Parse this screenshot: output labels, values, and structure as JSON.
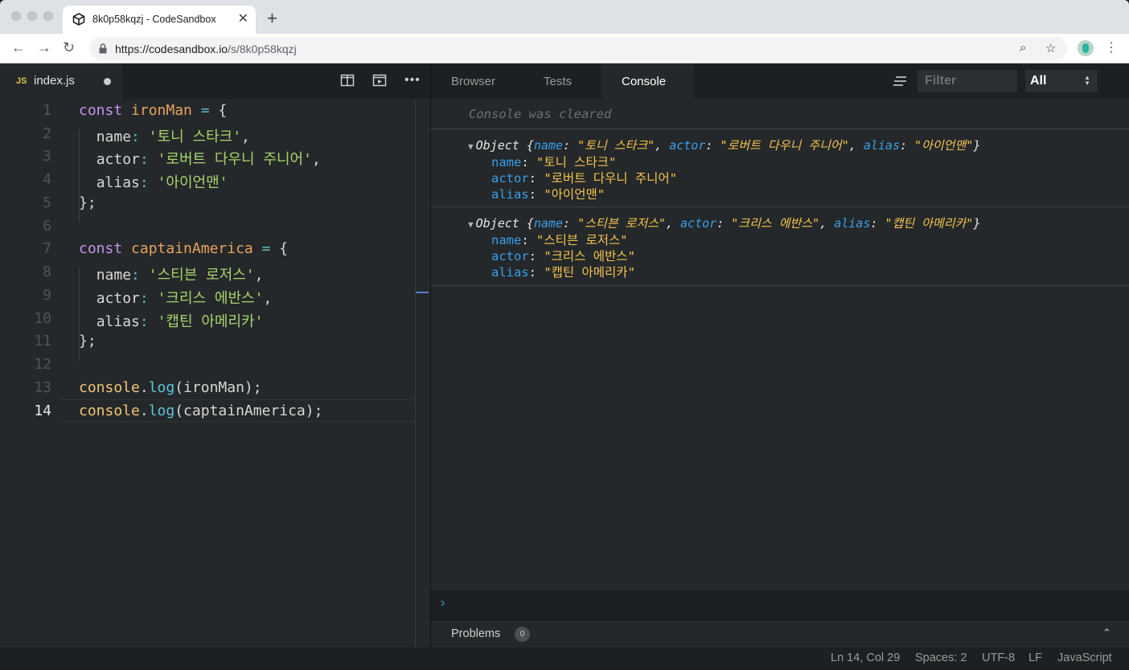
{
  "browser": {
    "tab_title": "8k0p58kqzj - CodeSandbox",
    "tab_close": "✕",
    "new_tab": "+",
    "url_host": "https://codesandbox.io",
    "url_path": "/s/8k0p58kqzj",
    "icons": [
      "back-arrow-icon",
      "forward-arrow-icon",
      "reload-icon",
      "lock-icon",
      "zoom-icon",
      "star-icon",
      "avatar",
      "kebab-menu-icon"
    ]
  },
  "editor": {
    "file_badge": "JS",
    "file_name": "index.js",
    "line_numbers": [
      "1",
      "2",
      "3",
      "4",
      "5",
      "6",
      "7",
      "8",
      "9",
      "10",
      "11",
      "12",
      "13",
      "14"
    ],
    "active_line": "14",
    "code": {
      "l1": {
        "kw": "const",
        "var": "ironMan",
        "op": "=",
        "punc": "{"
      },
      "l2": {
        "key": "name",
        "colon": ":",
        "str": "'토니 스타크'",
        "comma": ","
      },
      "l3": {
        "key": "actor",
        "colon": ":",
        "str": "'로버트 다우니 주니어'",
        "comma": ","
      },
      "l4": {
        "key": "alias",
        "colon": ":",
        "str": "'아이언맨'"
      },
      "l5": "};",
      "l7": {
        "kw": "const",
        "var": "captainAmerica",
        "op": "=",
        "punc": "{"
      },
      "l8": {
        "key": "name",
        "colon": ":",
        "str": "'스티븐 로저스'",
        "comma": ","
      },
      "l9": {
        "key": "actor",
        "colon": ":",
        "str": "'크리스 에반스'",
        "comma": ","
      },
      "l10": {
        "key": "alias",
        "colon": ":",
        "str": "'캡틴 아메리카'"
      },
      "l11": "};",
      "l13": {
        "obj": "console",
        "dot": ".",
        "fn": "log",
        "args": "(ironMan);"
      },
      "l14": {
        "obj": "console",
        "dot": ".",
        "fn": "log",
        "args": "(captainAmerica);"
      }
    }
  },
  "panel": {
    "tabs": [
      "Browser",
      "Tests",
      "Console"
    ],
    "active_tab": "Console",
    "filter_placeholder": "Filter",
    "level_selected": "All",
    "cleared_message": "Console was cleared",
    "entries": [
      {
        "type_label": "Object",
        "open_brace": "{",
        "close_brace": "}",
        "props": [
          {
            "key": "name",
            "value": "\"토니 스타크\""
          },
          {
            "key": "actor",
            "value": "\"로버트 다우니 주니어\""
          },
          {
            "key": "alias",
            "value": "\"아이언맨\""
          }
        ]
      },
      {
        "type_label": "Object",
        "open_brace": "{",
        "close_brace": "}",
        "props": [
          {
            "key": "name",
            "value": "\"스티븐 로저스\""
          },
          {
            "key": "actor",
            "value": "\"크리스 에반스\""
          },
          {
            "key": "alias",
            "value": "\"캡틴 아메리카\""
          }
        ]
      }
    ],
    "prompt": "›",
    "problems_label": "Problems",
    "problems_count": "0"
  },
  "status": {
    "position": "Ln 14, Col 29",
    "spaces": "Spaces: 2",
    "encoding": "UTF-8",
    "eol": "LF",
    "language": "JavaScript"
  },
  "colors": {
    "keyword": "#c792ea",
    "variable": "#e8a35c",
    "string": "#a9d46b",
    "console_key": "#3a9fe8",
    "console_value": "#f5c44f"
  }
}
